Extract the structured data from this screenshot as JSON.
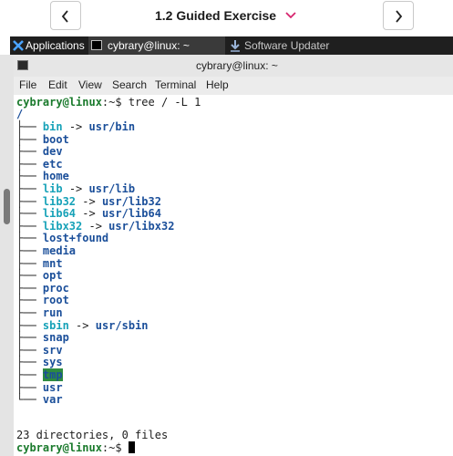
{
  "lesson_nav": {
    "title": "1.2 Guided Exercise",
    "prev_icon": "chevron-left-icon",
    "next_icon": "chevron-right-icon",
    "dropdown_icon": "chevron-down-icon",
    "accent": "#d6246e"
  },
  "panel": {
    "applications_label": "Applications",
    "tasks": [
      {
        "label": "cybrary@linux: ~",
        "icon": "terminal-icon",
        "active": true
      },
      {
        "label": "Software Updater",
        "icon": "download-icon",
        "active": false
      }
    ]
  },
  "window": {
    "title": "cybrary@linux: ~",
    "menu": [
      "File",
      "Edit",
      "View",
      "Search",
      "Terminal",
      "Help"
    ]
  },
  "terminal": {
    "prompt_user": "cybrary@linux",
    "prompt_suffix": ":~$ ",
    "command": "tree / -L 1",
    "root": "/",
    "entries": [
      {
        "name": "bin",
        "kind": "link",
        "target": "usr/bin"
      },
      {
        "name": "boot",
        "kind": "dir"
      },
      {
        "name": "dev",
        "kind": "dir"
      },
      {
        "name": "etc",
        "kind": "dir"
      },
      {
        "name": "home",
        "kind": "dir"
      },
      {
        "name": "lib",
        "kind": "link",
        "target": "usr/lib"
      },
      {
        "name": "lib32",
        "kind": "link",
        "target": "usr/lib32"
      },
      {
        "name": "lib64",
        "kind": "link",
        "target": "usr/lib64"
      },
      {
        "name": "libx32",
        "kind": "link",
        "target": "usr/libx32"
      },
      {
        "name": "lost+found",
        "kind": "dir"
      },
      {
        "name": "media",
        "kind": "dir"
      },
      {
        "name": "mnt",
        "kind": "dir"
      },
      {
        "name": "opt",
        "kind": "dir"
      },
      {
        "name": "proc",
        "kind": "dir"
      },
      {
        "name": "root",
        "kind": "dir"
      },
      {
        "name": "run",
        "kind": "dir"
      },
      {
        "name": "sbin",
        "kind": "link",
        "target": "usr/sbin"
      },
      {
        "name": "snap",
        "kind": "dir"
      },
      {
        "name": "srv",
        "kind": "dir"
      },
      {
        "name": "sys",
        "kind": "dir"
      },
      {
        "name": "tmp",
        "kind": "sticky"
      },
      {
        "name": "usr",
        "kind": "dir"
      },
      {
        "name": "var",
        "kind": "dir"
      }
    ],
    "summary": "23 directories, 0 files",
    "colors": {
      "directory": "#1b4f9a",
      "symlink": "#17a2b8",
      "prompt": "#1a7a2c",
      "sticky_bg": "#2e8b40"
    }
  }
}
